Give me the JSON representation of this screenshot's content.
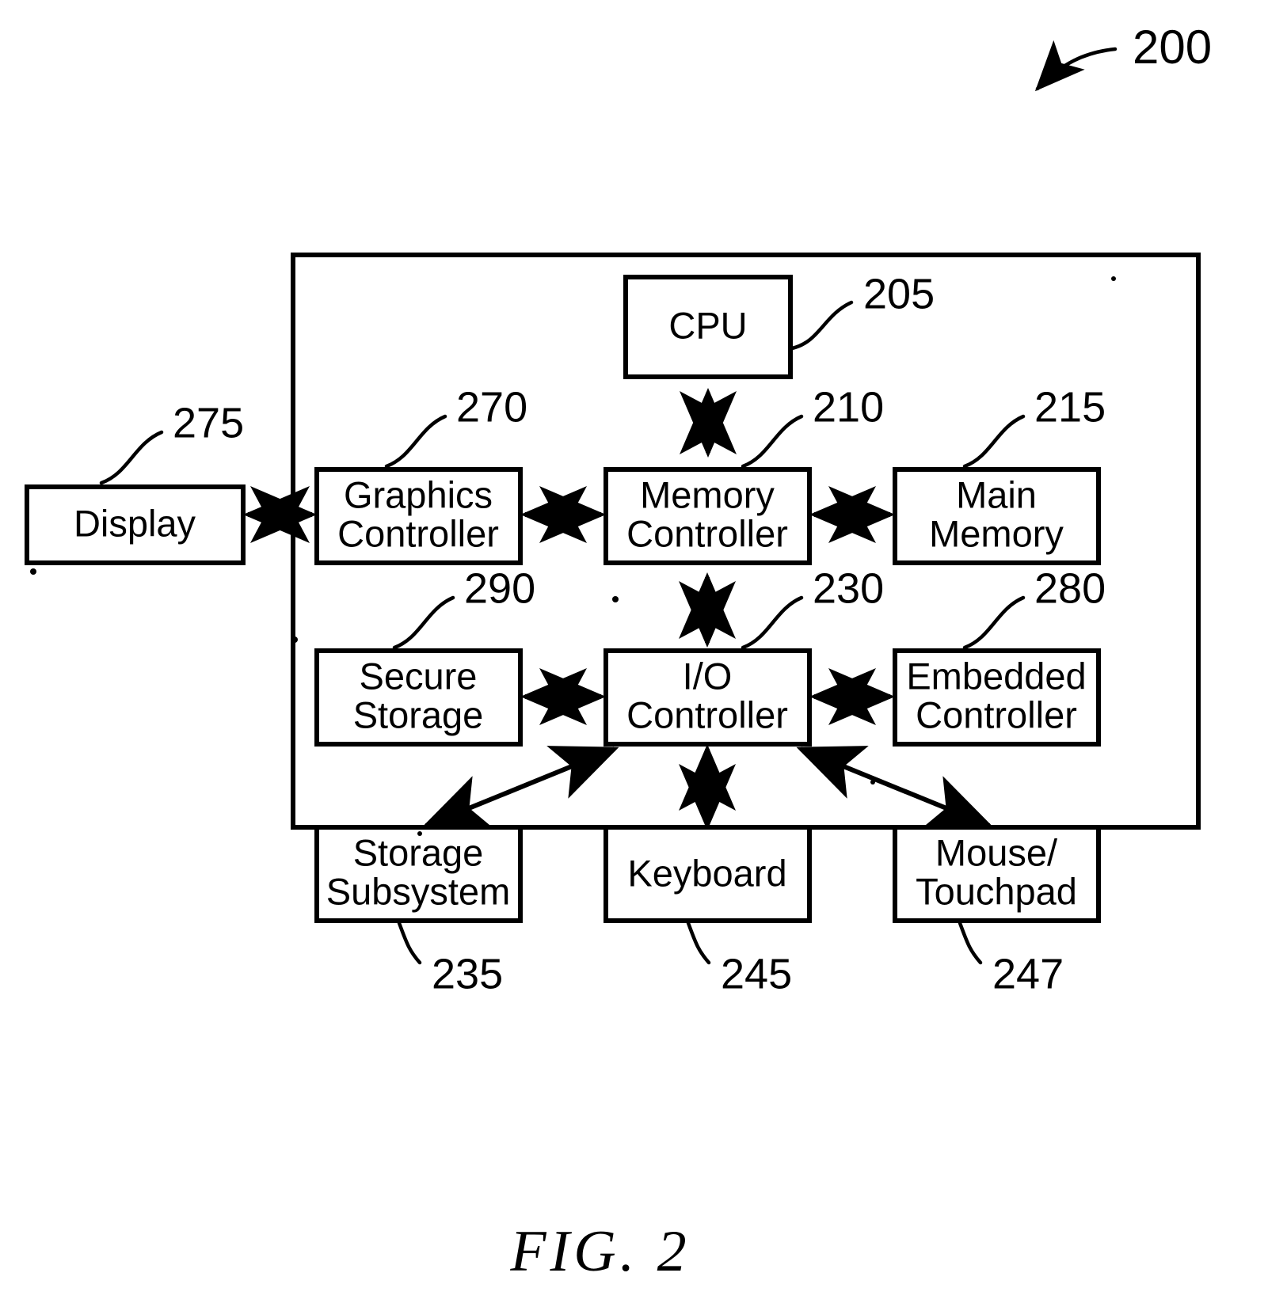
{
  "figure": {
    "caption": "FIG.  2",
    "system_ref": "200",
    "title": "Computer system block diagram"
  },
  "blocks": [
    {
      "id": "cpu",
      "label": "CPU",
      "lines": [
        "CPU"
      ],
      "ref": "205",
      "ref_position": "top-right"
    },
    {
      "id": "display",
      "label": "Display",
      "lines": [
        "Display"
      ],
      "ref": "275",
      "ref_position": "top-right"
    },
    {
      "id": "graphics-controller",
      "label": "Graphics Controller",
      "lines": [
        "Graphics",
        "Controller"
      ],
      "ref": "270",
      "ref_position": "top-right"
    },
    {
      "id": "memory-controller",
      "label": "Memory Controller",
      "lines": [
        "Memory",
        "Controller"
      ],
      "ref": "210",
      "ref_position": "top-right"
    },
    {
      "id": "main-memory",
      "label": "Main Memory",
      "lines": [
        "Main",
        "Memory"
      ],
      "ref": "215",
      "ref_position": "top-right"
    },
    {
      "id": "secure-storage",
      "label": "Secure Storage",
      "lines": [
        "Secure",
        "Storage"
      ],
      "ref": "290",
      "ref_position": "top-right"
    },
    {
      "id": "io-controller",
      "label": "I/O Controller",
      "lines": [
        "I/O",
        "Controller"
      ],
      "ref": "230",
      "ref_position": "top-right"
    },
    {
      "id": "embedded-controller",
      "label": "Embedded Controller",
      "lines": [
        "Embedded",
        "Controller"
      ],
      "ref": "280",
      "ref_position": "top-right"
    },
    {
      "id": "storage-subsystem",
      "label": "Storage Subsystem",
      "lines": [
        "Storage",
        "Subsystem"
      ],
      "ref": "235",
      "ref_position": "bottom-right"
    },
    {
      "id": "keyboard",
      "label": "Keyboard",
      "lines": [
        "Keyboard"
      ],
      "ref": "245",
      "ref_position": "bottom-right"
    },
    {
      "id": "mouse-touchpad",
      "label": "Mouse/ Touchpad",
      "lines": [
        "Mouse/",
        "Touchpad"
      ],
      "ref": "247",
      "ref_position": "bottom-right"
    }
  ],
  "labels": {
    "cpu": "CPU",
    "display": "Display",
    "graphics_1": "Graphics",
    "graphics_2": "Controller",
    "memory_1": "Memory",
    "memory_2": "Controller",
    "mainmem_1": "Main",
    "mainmem_2": "Memory",
    "secure_1": "Secure",
    "secure_2": "Storage",
    "io_1": "I/O",
    "io_2": "Controller",
    "embedded_1": "Embedded",
    "embedded_2": "Controller",
    "storage_1": "Storage",
    "storage_2": "Subsystem",
    "keyboard": "Keyboard",
    "mouse_1": "Mouse/",
    "mouse_2": "Touchpad"
  },
  "refs": {
    "system": "200",
    "cpu": "205",
    "memory_controller": "210",
    "main_memory": "215",
    "io_controller": "230",
    "storage_subsystem": "235",
    "keyboard": "245",
    "mouse_touchpad": "247",
    "graphics_controller": "270",
    "display": "275",
    "embedded_controller": "280",
    "secure_storage": "290"
  },
  "connections": [
    {
      "from": "cpu",
      "to": "memory-controller",
      "style": "double-arrow",
      "orientation": "vertical"
    },
    {
      "from": "display",
      "to": "graphics-controller",
      "style": "double-arrow",
      "orientation": "horizontal"
    },
    {
      "from": "graphics-controller",
      "to": "memory-controller",
      "style": "double-arrow",
      "orientation": "horizontal"
    },
    {
      "from": "memory-controller",
      "to": "main-memory",
      "style": "double-arrow",
      "orientation": "horizontal"
    },
    {
      "from": "memory-controller",
      "to": "io-controller",
      "style": "double-arrow",
      "orientation": "vertical"
    },
    {
      "from": "secure-storage",
      "to": "io-controller",
      "style": "double-arrow",
      "orientation": "horizontal"
    },
    {
      "from": "io-controller",
      "to": "embedded-controller",
      "style": "double-arrow",
      "orientation": "horizontal"
    },
    {
      "from": "io-controller",
      "to": "storage-subsystem",
      "style": "double-arrow",
      "orientation": "diagonal"
    },
    {
      "from": "io-controller",
      "to": "keyboard",
      "style": "double-arrow",
      "orientation": "vertical"
    },
    {
      "from": "io-controller",
      "to": "mouse-touchpad",
      "style": "double-arrow",
      "orientation": "diagonal"
    }
  ],
  "colors": {
    "ink": "#000000",
    "paper": "#ffffff"
  }
}
